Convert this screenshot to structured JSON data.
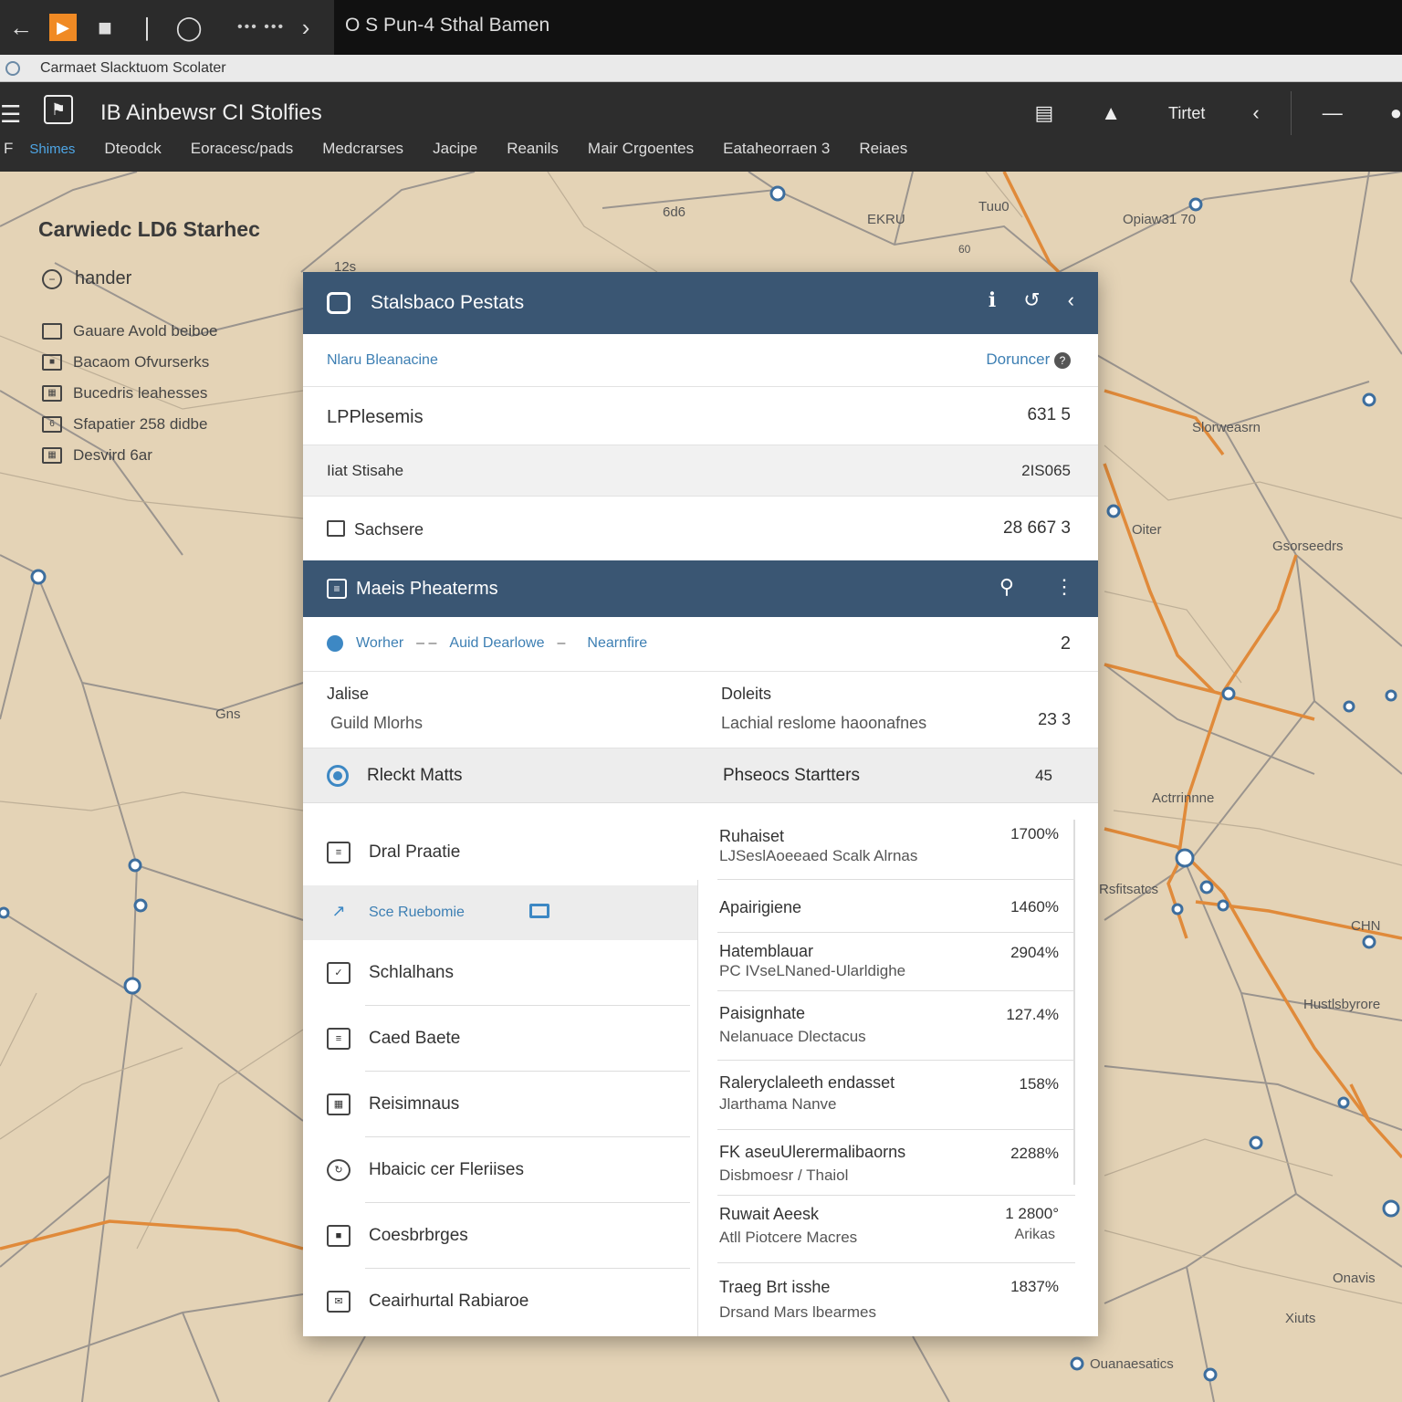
{
  "window": {
    "title": "O S Pun-4 Sthal Bamen",
    "menu_dots": "••• •••",
    "address": "Carmaet Slacktuom Scolater"
  },
  "app": {
    "title": "IB Ainbewsr CI Stolfies",
    "action_text": "Tirtet",
    "nav": [
      "F",
      "Shimes",
      "Dteodck",
      "Eoracesc/pads",
      "Medcrarses",
      "Jacipe",
      "Reanils",
      "Mair Crgoentes",
      "Eataheorraen 3",
      "Reiaes"
    ]
  },
  "sidebar": {
    "title": "Carwiedc LD6 Starhec",
    "search_label": "hander",
    "items": [
      {
        "label": "Gauare Avold beiboe",
        "icon": "list-icon"
      },
      {
        "label": "Bacaom Ofvurserks",
        "icon": "box-icon"
      },
      {
        "label": "Bucedris leahesses",
        "icon": "photo-icon"
      },
      {
        "label": "Sfapatier 258 didbe",
        "icon": "document-icon"
      },
      {
        "label": "Desvird 6ar",
        "icon": "grid-icon"
      }
    ]
  },
  "panel": {
    "title": "Stalsbaco Pestats",
    "link_left": "Nlaru Bleanacine",
    "link_right": "Doruncer",
    "rows": [
      {
        "label": "LPPlesemis",
        "value": "631  5"
      },
      {
        "label": "Iiat Stisahe",
        "value": "2IS065"
      },
      {
        "label": "Sachsere",
        "value": "28 667  3"
      }
    ],
    "section": {
      "title": "Maeis Pheaterms",
      "crumbs": [
        "Worher",
        "Auid Dearlowe",
        "Nearnfire"
      ],
      "crumb_count": "2",
      "col_row": {
        "left_title": "Jalise",
        "left_sub": "Guild Mlorhs",
        "right_title": "Doleits",
        "right_sub": "Lachial reslome haoonafnes",
        "value": "2З  3"
      },
      "selected": {
        "left": "Rleckt Matts",
        "right": "Phseocs Startters",
        "value": "45"
      },
      "left_items": [
        {
          "label": "Dral Praatie",
          "icon": "clipboard-icon"
        },
        {
          "label": "Sce Ruebomie",
          "icon": "chart-icon",
          "active": true,
          "tail_icon": "monitor-icon"
        },
        {
          "label": "Schlalhans",
          "icon": "check-icon"
        },
        {
          "label": "Caed Baete",
          "icon": "list-icon"
        },
        {
          "label": "Reisimnaus",
          "icon": "photo-icon"
        },
        {
          "label": "Hbaicic cer Fleriises",
          "icon": "refresh-icon"
        },
        {
          "label": "Coesbrbrges",
          "icon": "box-icon"
        },
        {
          "label": "Ceairhurtal Rabiaroe",
          "icon": "mail-icon"
        }
      ],
      "right_items": [
        {
          "title": "Ruhaiset",
          "sub": "LJSeslAoeeaed Scalk Alrnas",
          "value": "1700%"
        },
        {
          "title": "Apairigiene",
          "sub": "",
          "value": "1460%"
        },
        {
          "title": "Hatemblauar",
          "sub": "PC IVseLNaned-Ularldighe",
          "value": "2904%"
        },
        {
          "title": "Paisignhate",
          "sub": "Nelanuace Dlectacus",
          "value": "127.4%"
        },
        {
          "title": "Raleryclaleeth endasset",
          "sub": "Jlarthama Nanve",
          "value": "158%"
        },
        {
          "title": "FK aseuUlerermalibaorns",
          "sub": "Disbmoesr / Thaiol",
          "value": "2288%"
        },
        {
          "title": "Ruwait Aeesk",
          "sub": "Atll Piotcere Macres",
          "value": "1 2800°",
          "value2": "Arikas"
        },
        {
          "title": "Traeg Brt isshe",
          "sub": "Drsand Mars lbearmes",
          "value": "1837%"
        }
      ]
    }
  },
  "map": {
    "labels": [
      "12s",
      "6d6",
      "EKRU",
      "60",
      "Tuu0",
      "Opiaw31 70",
      "Slorweasrn",
      "Oiter",
      "Gsorseedrs",
      "Actrrinnne",
      "Rsfitsatcs",
      "CHN",
      "Hustlsbyrore",
      "Onavis",
      "Xiuts",
      "Ouanaesatics",
      "Gns"
    ]
  },
  "colors": {
    "panel_header": "#3a5673",
    "accent": "#3d88c4",
    "road_major": "#e08a3a",
    "map_bg": "#e4d3b6"
  }
}
